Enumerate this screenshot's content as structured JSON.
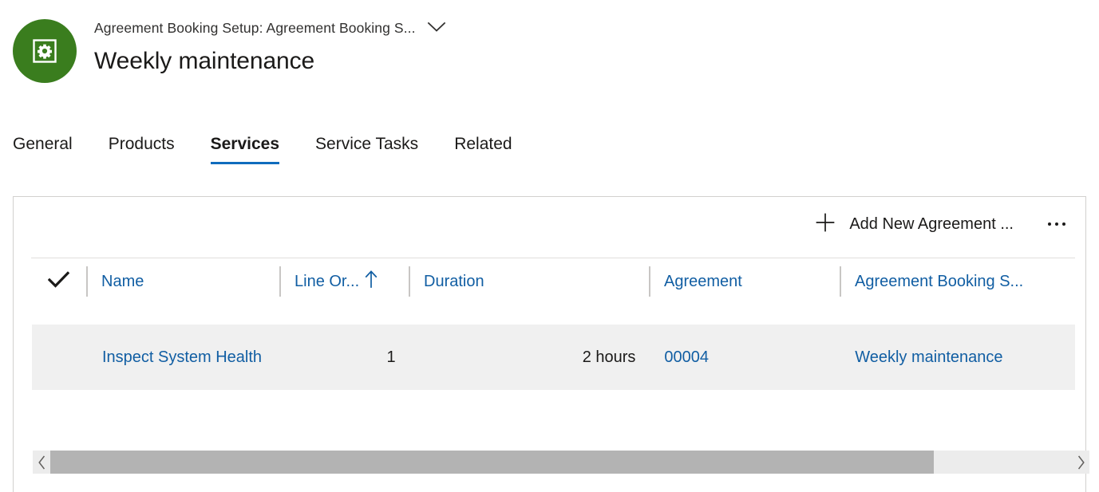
{
  "header": {
    "avatar_icon": "gear-in-square-icon",
    "avatar_color": "#3a7d1e",
    "breadcrumb": "Agreement Booking Setup: Agreement Booking S...",
    "breadcrumb_chevron_icon": "chevron-down-icon",
    "title": "Weekly maintenance"
  },
  "tabs": [
    {
      "label": "General",
      "active": false
    },
    {
      "label": "Products",
      "active": false
    },
    {
      "label": "Services",
      "active": true
    },
    {
      "label": "Service Tasks",
      "active": false
    },
    {
      "label": "Related",
      "active": false
    }
  ],
  "accent_color": "#0f6cbd",
  "link_color": "#115ea3",
  "command_bar": {
    "add_icon": "plus-icon",
    "add_label": "Add New Agreement ...",
    "overflow_icon": "more-ellipsis-icon"
  },
  "grid": {
    "select_all_icon": "checkmark-icon",
    "columns": [
      {
        "label": "Name",
        "sorted": false
      },
      {
        "label": "Line Or...",
        "sorted": true,
        "sort_icon": "sort-ascending-arrow-icon"
      },
      {
        "label": "Duration",
        "sorted": false
      },
      {
        "label": "Agreement",
        "sorted": false
      },
      {
        "label": "Agreement Booking S...",
        "sorted": false
      }
    ],
    "rows": [
      {
        "name": "Inspect System Health",
        "line_order": "1",
        "duration": "2 hours",
        "agreement": "00004",
        "agreement_booking_setup": "Weekly maintenance"
      }
    ]
  },
  "scrollbar": {
    "left_arrow_icon": "chevron-left-icon",
    "right_arrow_icon": "chevron-right-icon",
    "thumb_fraction": "86.5%"
  }
}
